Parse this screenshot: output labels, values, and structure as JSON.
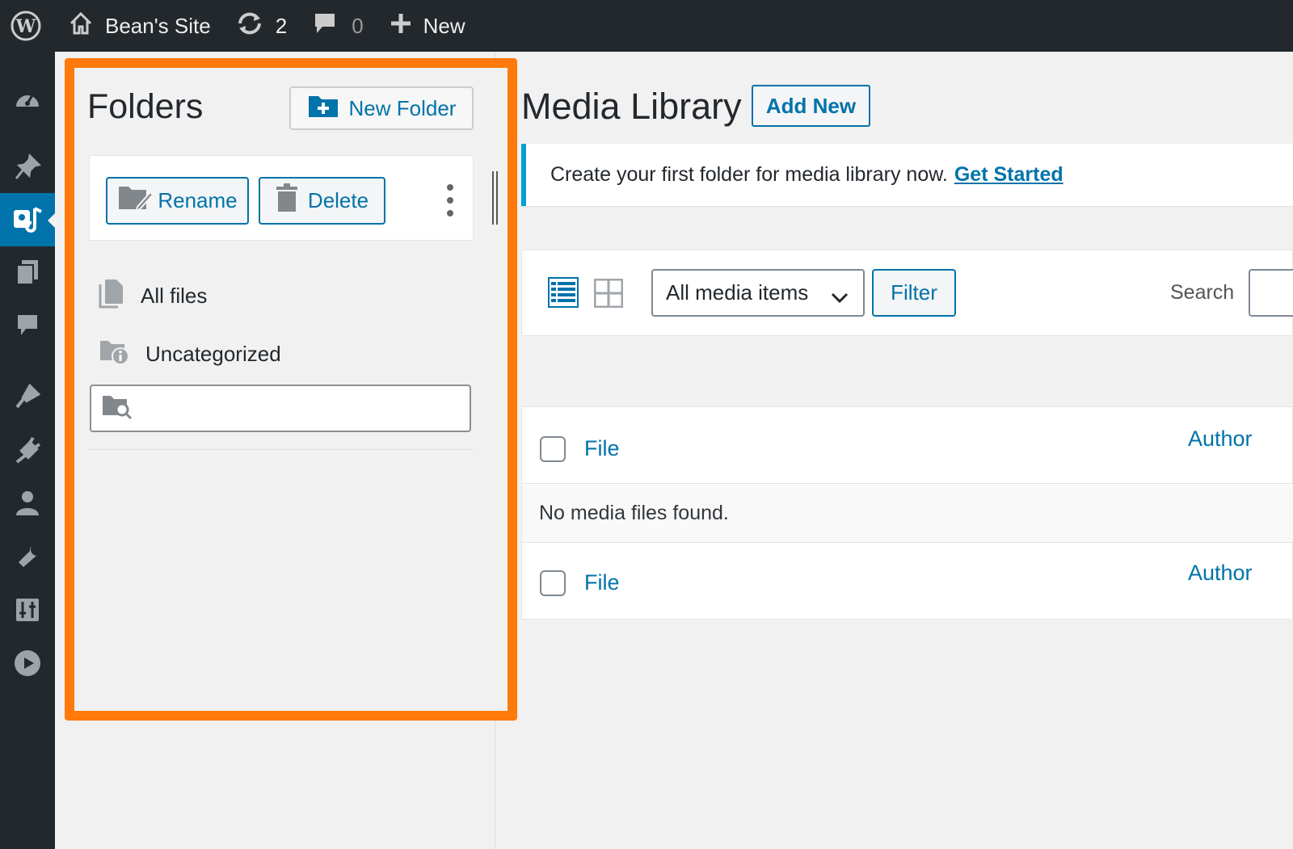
{
  "admin_bar": {
    "site_name": "Bean's Site",
    "updates_count": "2",
    "comments_count": "0",
    "new_label": "New"
  },
  "folders": {
    "title": "Folders",
    "new_folder_label": "New Folder",
    "rename_label": "Rename",
    "delete_label": "Delete",
    "items": [
      {
        "label": "All files",
        "icon": "file-icon"
      },
      {
        "label": "Uncategorized",
        "icon": "folder-info-icon"
      }
    ],
    "search_placeholder": ""
  },
  "main": {
    "title": "Media Library",
    "add_new_label": "Add New",
    "notice_text": "Create your first folder for media library now.",
    "notice_link": "Get Started",
    "filter_select_value": "All media items",
    "filter_button": "Filter",
    "search_label": "Search",
    "table": {
      "columns": [
        "File",
        "Author"
      ],
      "empty_message": "No media files found."
    }
  },
  "colors": {
    "admin_bar_bg": "#23282d",
    "accent": "#0073aa",
    "highlight_border": "#ff7a0a",
    "notice_border": "#00a0d2"
  }
}
